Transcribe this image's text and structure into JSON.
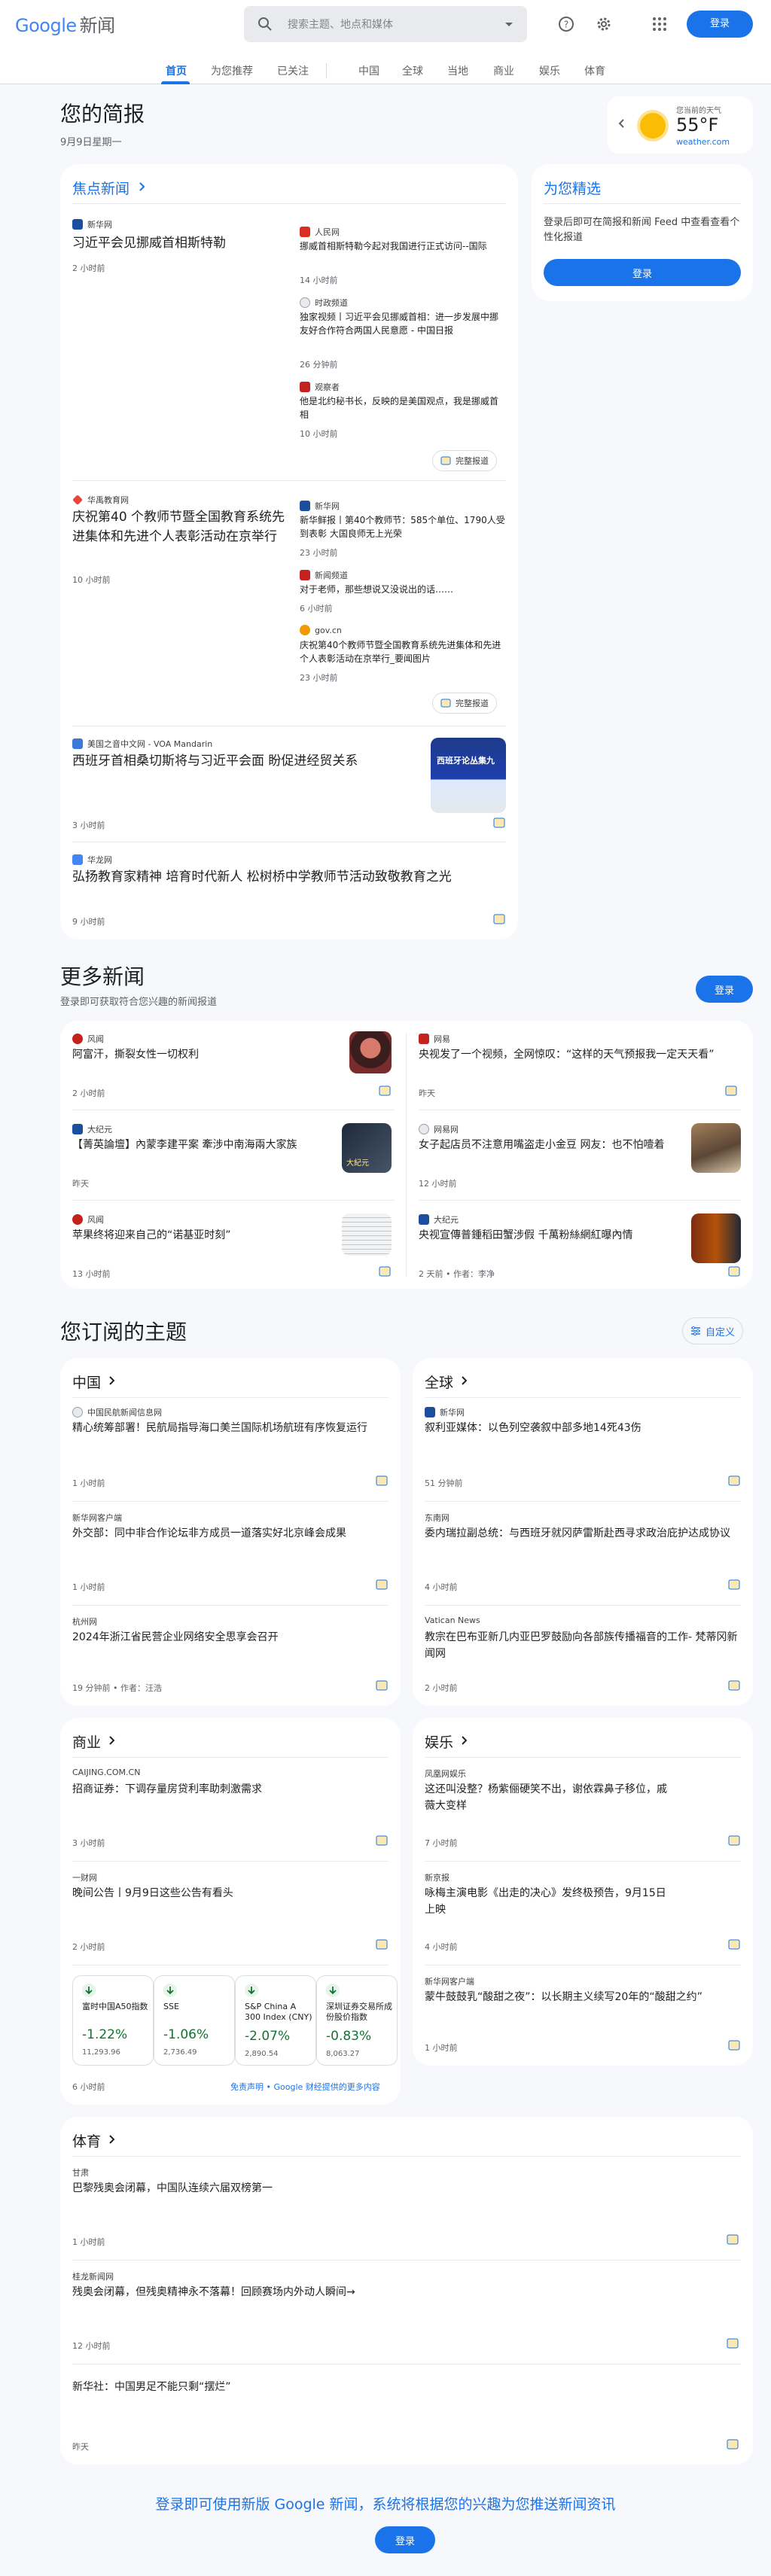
{
  "header": {
    "logo_google": "Google",
    "logo_news": "新闻",
    "search_placeholder": "搜索主题、地点和媒体",
    "login": "登录"
  },
  "nav": {
    "tabs": [
      "首页",
      "为您推荐",
      "已关注",
      "中国",
      "全球",
      "当地",
      "商业",
      "娱乐",
      "体育"
    ]
  },
  "briefing": {
    "title": "您的简报",
    "date": "9月9日星期一"
  },
  "weather": {
    "label": "您当前的天气",
    "temp": "55°F",
    "source": "weather.com"
  },
  "top": {
    "heading": "焦点新闻",
    "full_coverage": "完整报道",
    "stories": [
      {
        "source": "新华网",
        "title": "习近平会见挪威首相斯特勒",
        "time": "2 小时前",
        "related": [
          {
            "source": "人民网",
            "title": "挪威首相斯特勒今起对我国进行正式访问--国际",
            "time": "14 小时前"
          },
          {
            "source": "时政频道",
            "title": "独家视频丨习近平会见挪威首相：进一步发展中挪友好合作符合两国人民意愿 - 中国日报",
            "time": "26 分钟前"
          },
          {
            "source": "观察者",
            "title": "他是北约秘书长，反映的是美国观点，我是挪威首相",
            "time": "10 小时前"
          }
        ]
      },
      {
        "source": "华禹教育网",
        "title": "庆祝第40 个教师节暨全国教育系统先进集体和先进个人表彰活动在京举行",
        "time": "10 小时前",
        "related": [
          {
            "source": "新华网",
            "title": "新华鲜报丨第40个教师节：585个单位、1790人受到表彰 大国良师无上光荣",
            "time": "23 小时前"
          },
          {
            "source": "新闻频道",
            "title": "对于老师，那些想说又没说出的话……",
            "time": "6 小时前"
          },
          {
            "source": "gov.cn",
            "title": "庆祝第40个教师节暨全国教育系统先进集体和先进个人表彰活动在京举行_要闻图片",
            "time": "23 小时前"
          }
        ]
      },
      {
        "source": "美国之音中文网 - VOA Mandarin",
        "title": "西班牙首相桑切斯将与习近平会面 盼促进经贸关系",
        "time": "3 小时前",
        "thumb_text": "西班牙论丛集九"
      },
      {
        "source": "华龙网",
        "title": "弘扬教育家精神 培育时代新人 松树桥中学教师节活动致敬教育之光",
        "time": "9 小时前"
      }
    ]
  },
  "picks": {
    "title": "为您精选",
    "desc": "登录后即可在简报和新闻 Feed 中查看查看个性化报道",
    "login": "登录"
  },
  "more": {
    "title": "更多新闻",
    "sub": "登录即可获取符合您兴趣的新闻报道",
    "login": "登录",
    "items": [
      {
        "source": "风闻",
        "title": "阿富汗，撕裂女性一切权利",
        "time": "2 小时前"
      },
      {
        "source": "网易",
        "title": "央视发了一个视频，全网惊叹：“这样的天气预报我一定天天看”",
        "time": "昨天"
      },
      {
        "source": "大纪元",
        "title": "【菁英論壇】內蒙李建平案 牽涉中南海兩大家族",
        "time": "昨天",
        "thumb_text": "大紀元"
      },
      {
        "source": "网易网",
        "title": "女子起店员不注意用嘴盗走小金豆 网友：也不怕噎着",
        "time": "12 小时前"
      },
      {
        "source": "风闻",
        "title": "苹果终将迎来自己的“诺基亚时刻”",
        "time": "13 小时前"
      },
      {
        "source": "大纪元",
        "title": "央视宣傳普鍾稻田蟹涉假 千萬粉絲網紅曝內情",
        "time": "2 天前 • 作者：李净"
      }
    ]
  },
  "topics": {
    "title": "您订阅的主题",
    "customize": "自定义",
    "china": {
      "name": "中国",
      "items": [
        {
          "source": "中国民航新闻信息网",
          "title": "精心统筹部署！民航局指导海口美兰国际机场航班有序恢复运行",
          "time": "1 小时前"
        },
        {
          "source": "新华网客户端",
          "title": "外交部：同中非合作论坛非方成员一道落实好北京峰会成果",
          "time": "1 小时前"
        },
        {
          "source": "杭州网",
          "title": "2024年浙江省民营企业网络安全思享会召开",
          "time": "19 分钟前 • 作者：汪浩"
        }
      ]
    },
    "world": {
      "name": "全球",
      "items": [
        {
          "source": "新华网",
          "title": "叙利亚媒体：以色列空袭叙中部多地14死43伤",
          "time": "51 分钟前"
        },
        {
          "source": "东南网",
          "title": "委内瑞拉副总统：与西班牙就冈萨雷斯赴西寻求政治庇护达成协议",
          "time": "4 小时前"
        },
        {
          "source": "Vatican News",
          "title": "教宗在巴布亚新几内亚巴罗鼓励向各部族传播福音的工作- 梵蒂冈新闻网",
          "time": "2 小时前"
        }
      ]
    },
    "business": {
      "name": "商业",
      "items": [
        {
          "source": "CAIJING.COM.CN",
          "title": "招商证券：下调存量房贷利率助刺激需求",
          "time": "3 小时前"
        },
        {
          "source": "一财网",
          "title": "晚间公告丨9月9日这些公告有看头",
          "time": "2 小时前"
        }
      ],
      "stocks": [
        {
          "name": "富时中国A50指数",
          "pct": "-1.22%",
          "value": "11,293.96"
        },
        {
          "name": "SSE",
          "pct": "-1.06%",
          "value": "2,736.49"
        },
        {
          "name": "S&P China A 300 Index (CNY)",
          "pct": "-2.07%",
          "value": "2,890.54"
        },
        {
          "name": "深圳证券交易所成份股价指数",
          "pct": "-0.83%",
          "value": "8,063.27"
        }
      ],
      "stock_time": "6 小时前",
      "disclaimer": "免责声明 • Google 财经提供的更多内容"
    },
    "ent": {
      "name": "娱乐",
      "items": [
        {
          "source": "凤凰网娱乐",
          "title": "这还叫没整？杨紫俪硬笑不出，谢依霖鼻子移位，戚薇大变样",
          "time": "7 小时前"
        },
        {
          "source": "新京报",
          "title": "咏梅主演电影《出走的决心》发终极预告，9月15日上映",
          "time": "4 小时前"
        },
        {
          "source": "新华网客户端",
          "title": "蒙牛鼓鼓乳“酸甜之夜”：以长期主义续写20年的“酸甜之约”",
          "time": "1 小时前"
        }
      ]
    },
    "sports": {
      "name": "体育",
      "items": [
        {
          "source": "甘肃",
          "title": "巴黎残奥会闭幕，中国队连续六届双榜第一",
          "time": "1 小时前"
        },
        {
          "source": "桂龙新闻网",
          "title": "残奥会闭幕，但残奥精神永不落幕！回顾赛场内外动人瞬间→",
          "time": "12 小时前"
        },
        {
          "source": "",
          "title": "新华社：中国男足不能只剩“摆烂”",
          "time": "昨天"
        }
      ]
    }
  },
  "footer": {
    "text": "登录即可使用新版 Google 新闻，系统将根据您的兴趣为您推送新闻资讯",
    "login": "登录"
  },
  "colors": {
    "accent": "#1a73e8",
    "down": "#137333"
  }
}
